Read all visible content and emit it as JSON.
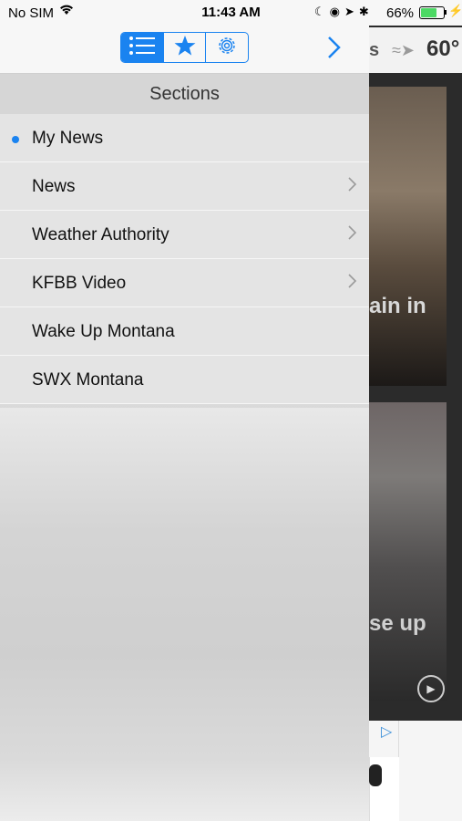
{
  "status_bar": {
    "carrier": "No SIM",
    "time": "11:43 AM",
    "battery_percent": "66%",
    "battery_level": 0.66
  },
  "toolbar": {
    "segments": [
      {
        "icon": "list-icon",
        "selected": true
      },
      {
        "icon": "star-icon",
        "selected": false
      },
      {
        "icon": "gear-icon",
        "selected": false
      }
    ],
    "accent_color": "#1a83f0"
  },
  "sections": {
    "title": "Sections",
    "items": [
      {
        "label": "My News",
        "selected": true,
        "has_children": false
      },
      {
        "label": "News",
        "selected": false,
        "has_children": true
      },
      {
        "label": "Weather Authority",
        "selected": false,
        "has_children": true
      },
      {
        "label": "KFBB Video",
        "selected": false,
        "has_children": true
      },
      {
        "label": "Wake Up Montana",
        "selected": false,
        "has_children": false
      },
      {
        "label": "SWX Montana",
        "selected": false,
        "has_children": false
      }
    ]
  },
  "background": {
    "header_fragment": "s",
    "temperature": "60°",
    "card1_text": "ain in",
    "card2_text": "se up"
  }
}
